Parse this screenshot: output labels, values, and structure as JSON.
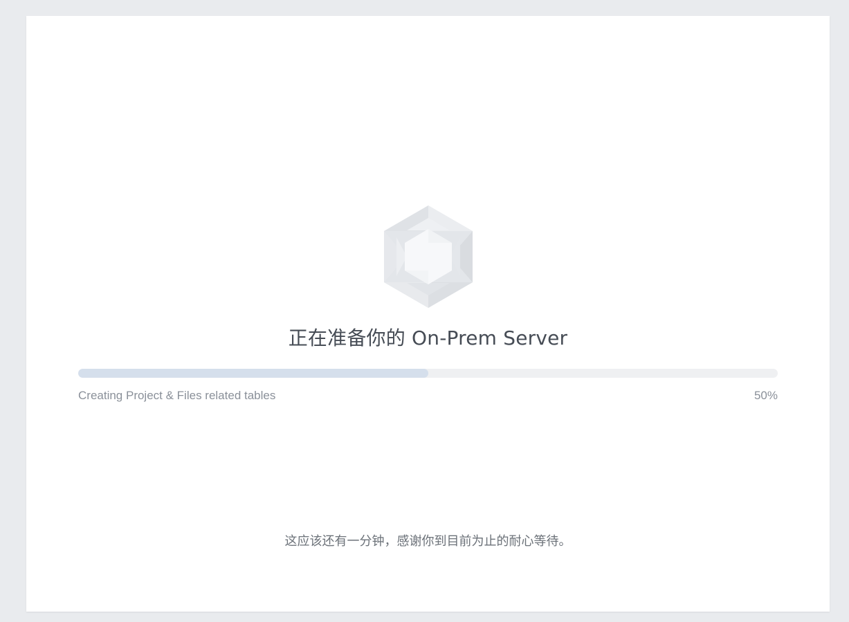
{
  "loading_screen": {
    "title": "正在准备你的 On-Prem Server",
    "progress": {
      "status_text": "Creating Project & Files related tables",
      "percent_label": "50%",
      "fraction": 0.5
    },
    "footer_note": "这应该还有一分钟，感谢你到目前为止的耐心等待。",
    "logo_icon": "hexagon-gem-logo-icon"
  },
  "colors": {
    "page_background": "#e9ebee",
    "card_background": "#ffffff",
    "progress_track": "#eff0f2",
    "progress_fill": "#d5dfec",
    "title_text": "#464c55",
    "muted_text": "#8a9099"
  }
}
